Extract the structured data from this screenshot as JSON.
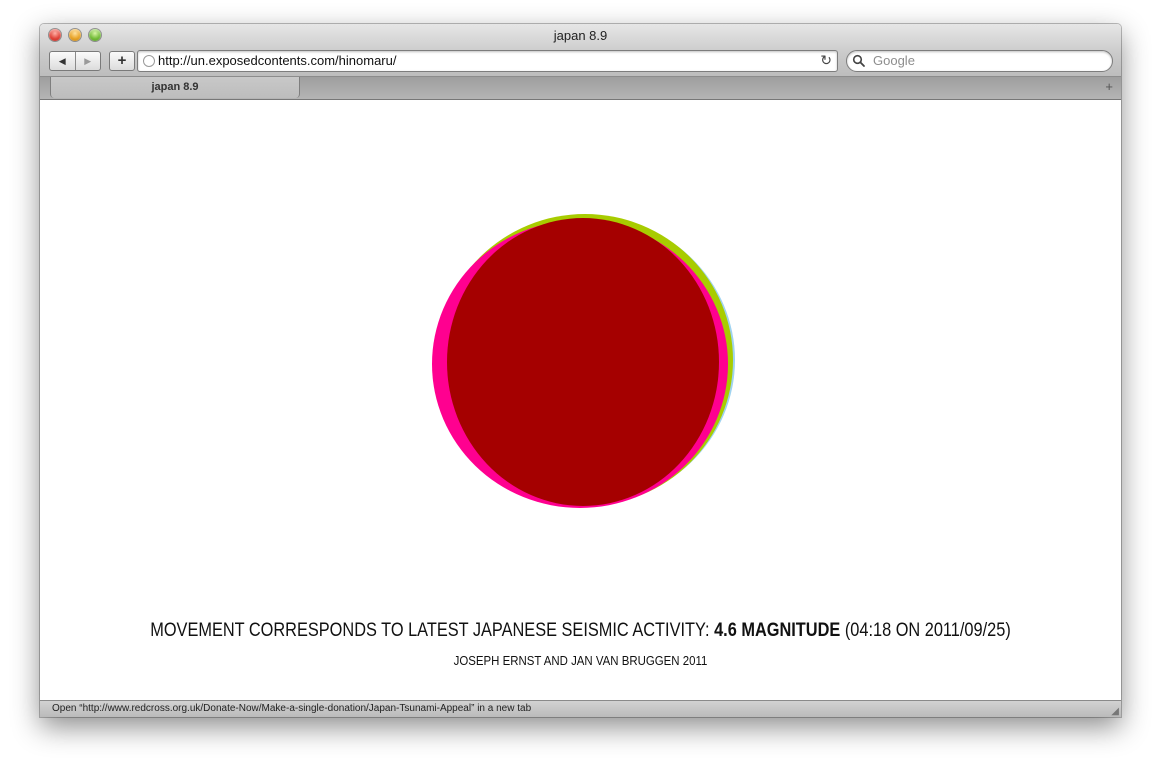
{
  "window": {
    "title": "japan 8.9"
  },
  "toolbar": {
    "back_icon": "◀",
    "forward_icon": "▶",
    "add_bookmark_label": "+",
    "url": "http://un.exposedcontents.com/hinomaru/",
    "reload_icon": "↻",
    "search_placeholder": "Google"
  },
  "tabs": [
    {
      "label": "japan 8.9",
      "active": true
    }
  ],
  "new_tab_icon": "+",
  "content": {
    "caption_prefix": "MOVEMENT CORRESPONDS TO LATEST JAPANESE SEISMIC ACTIVITY: ",
    "caption_magnitude": "4.6 MAGNITUDE",
    "caption_suffix": " (04:18 ON 2011/09/25)",
    "credit": "JOSEPH ERNST AND JAN VAN BRUGGEN 2011",
    "colors": {
      "magenta": "#ff0090",
      "yellow_green": "#a8cc00",
      "light_blue": "#9fd3f0",
      "red": "#a50000"
    }
  },
  "status_bar": {
    "text": "Open “http://www.redcross.org.uk/Donate-Now/Make-a-single-donation/Japan-Tsunami-Appeal” in a new tab"
  }
}
